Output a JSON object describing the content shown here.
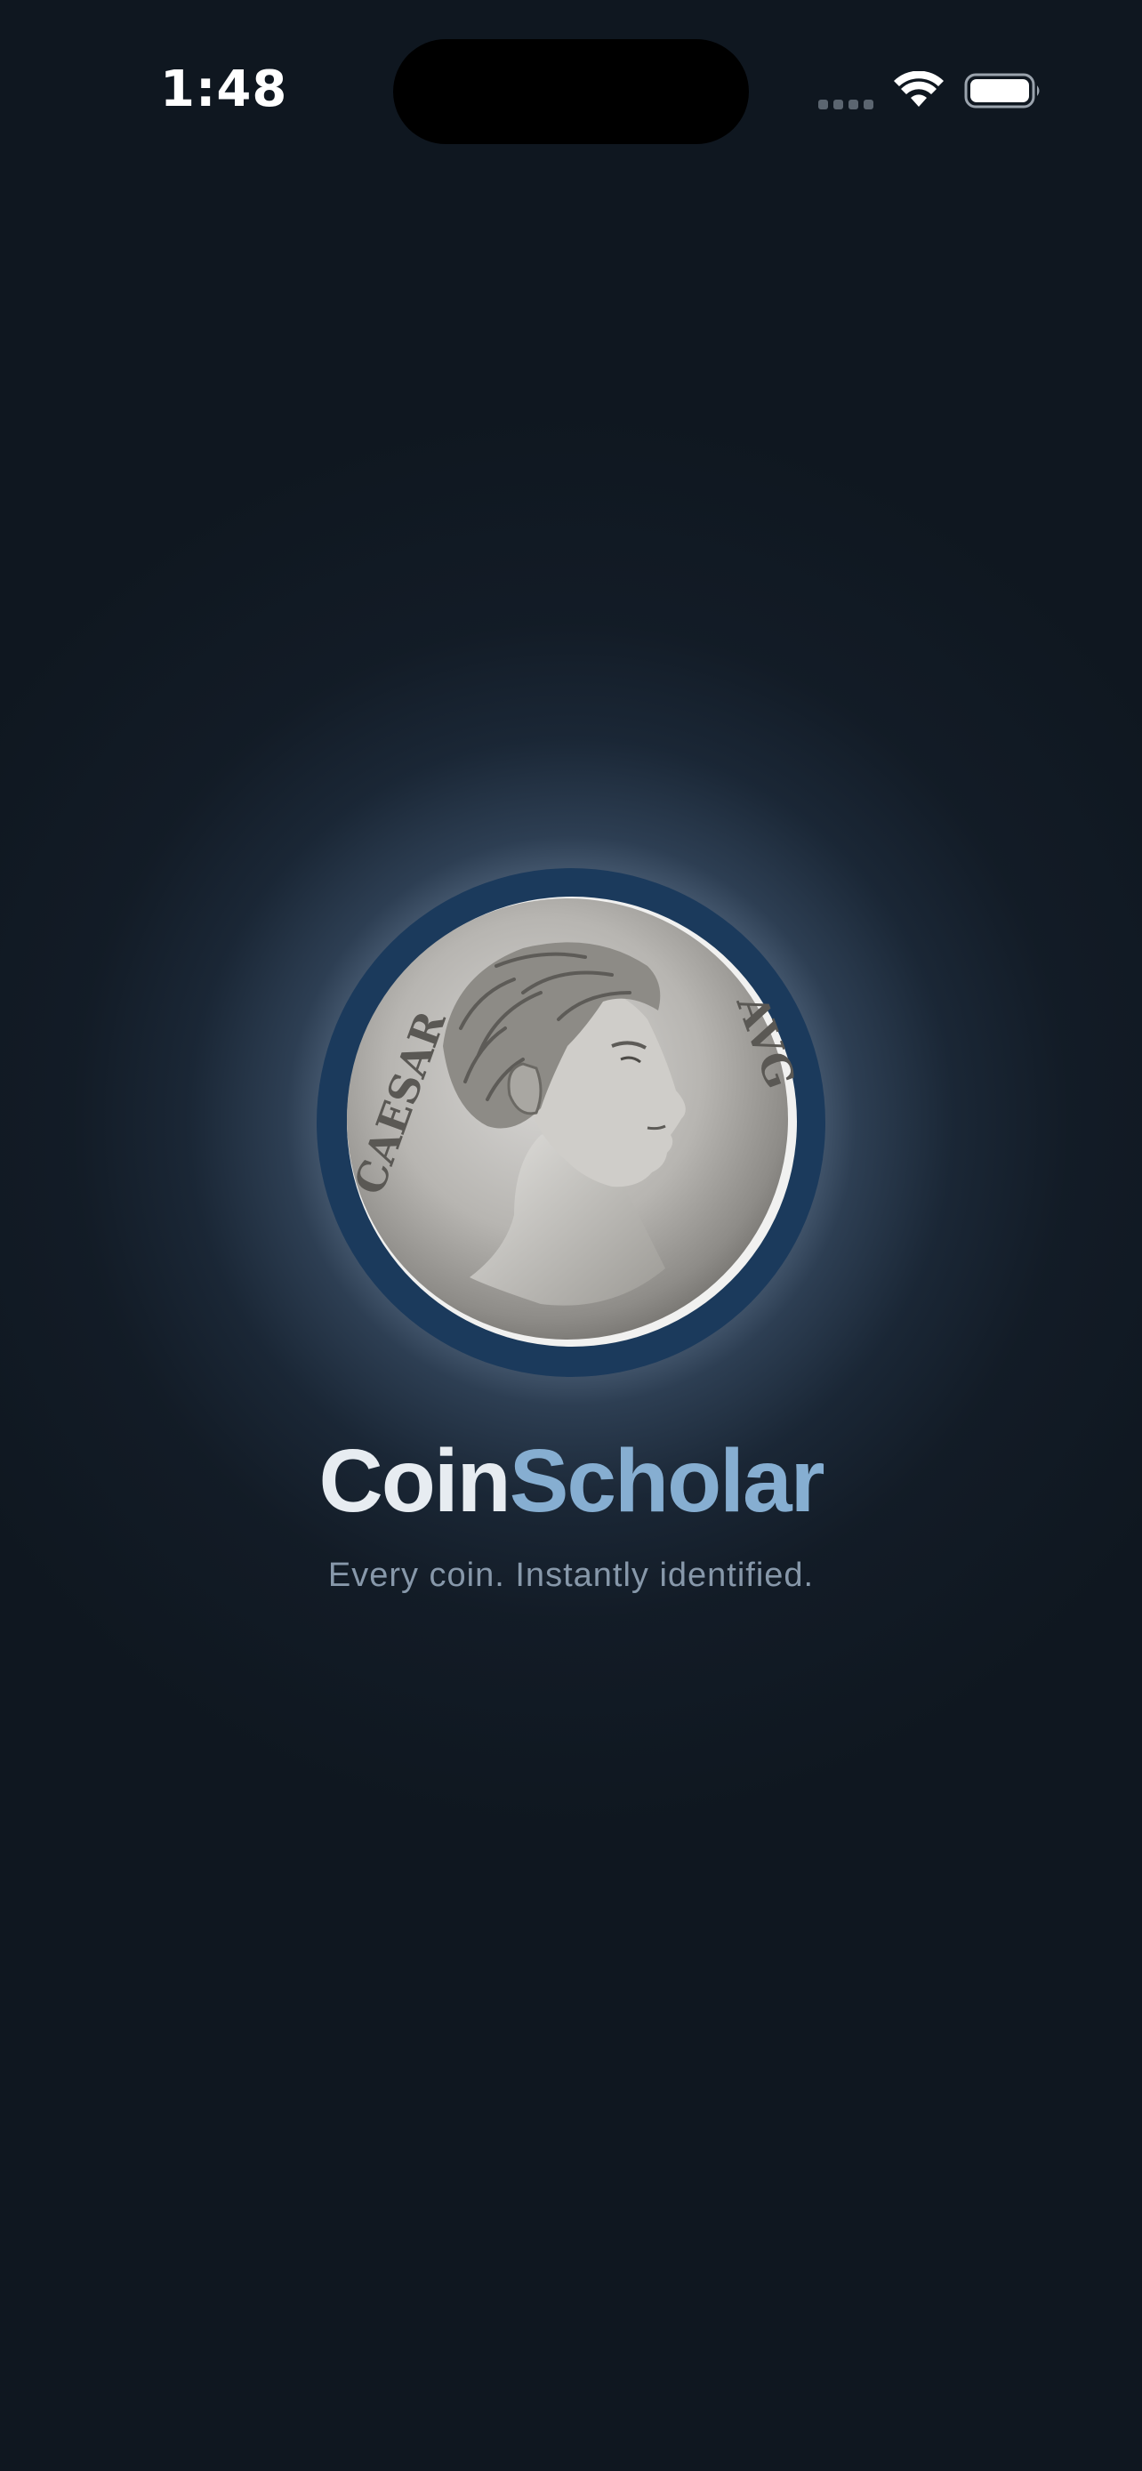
{
  "status_bar": {
    "time": "1:48",
    "signal_icon": "cellular-signal-icon",
    "wifi_icon": "wifi-icon",
    "battery_icon": "battery-icon"
  },
  "splash": {
    "coin_image": "roman-coin-image",
    "coin_inscription_left": "CAESAR",
    "coin_inscription_right": "AVG",
    "brand_part_1": "Coin",
    "brand_part_2": "Scholar",
    "tagline": "Every coin. Instantly identified."
  },
  "colors": {
    "background": "#0f1720",
    "ring": "#1b3a5c",
    "brand_primary": "#e7ecf1",
    "brand_accent": "#86aed1",
    "tagline": "#8798aa"
  }
}
